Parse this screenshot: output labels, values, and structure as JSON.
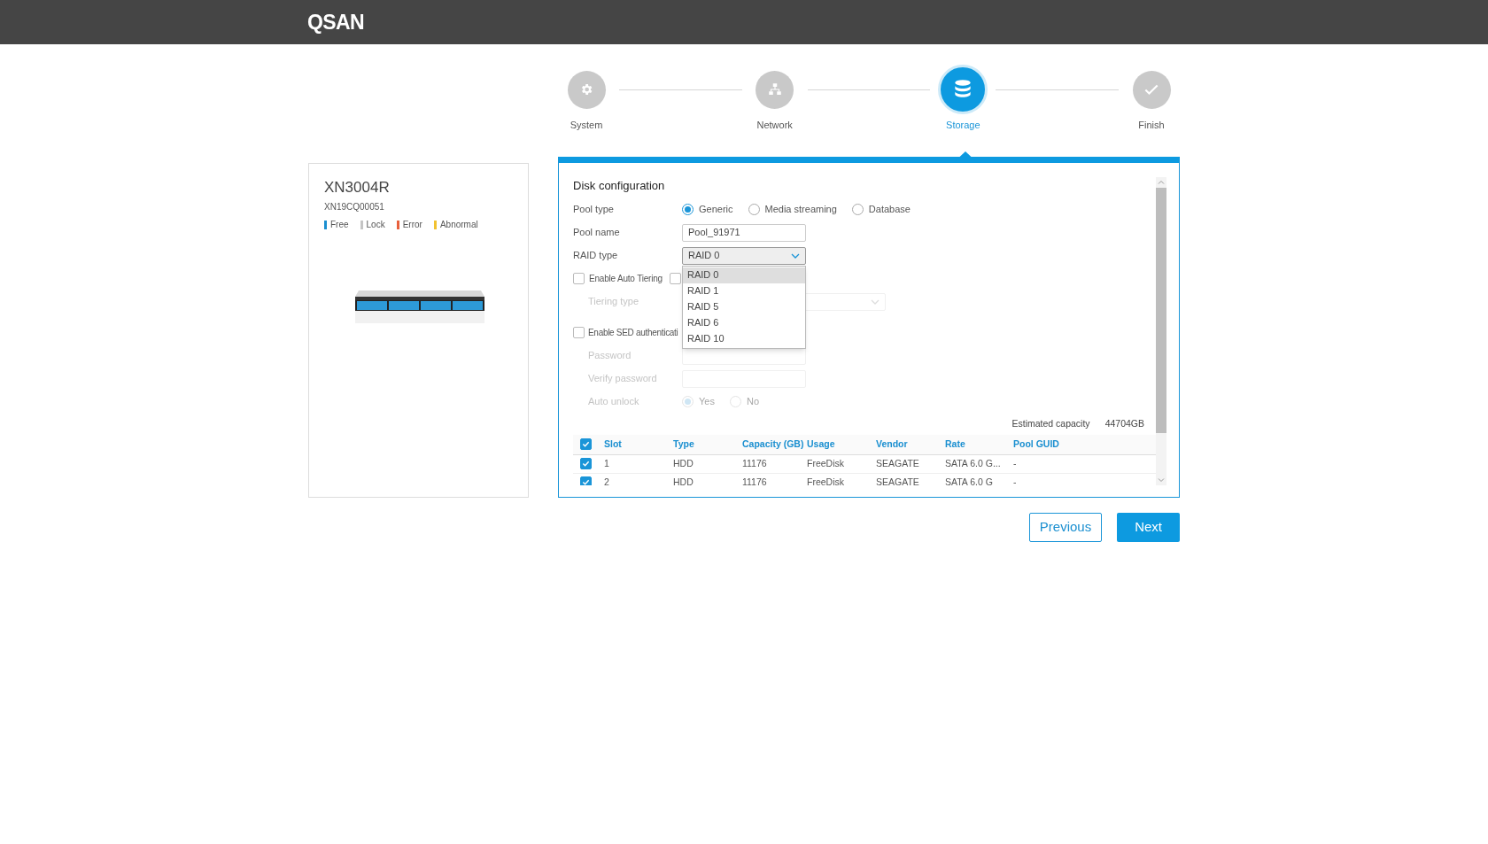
{
  "header": {
    "logo": "QSAN"
  },
  "steps": [
    {
      "label": "System",
      "selected": false
    },
    {
      "label": "Network",
      "selected": false
    },
    {
      "label": "Storage",
      "selected": true
    },
    {
      "label": "Finish",
      "selected": false
    }
  ],
  "device": {
    "model": "XN3004R",
    "serial": "XN19CQ00051",
    "legend": [
      {
        "label": "Free",
        "color": "#1a8fd0"
      },
      {
        "label": "Lock",
        "color": "#c4c4c4"
      },
      {
        "label": "Error",
        "color": "#e8603c"
      },
      {
        "label": "Abnormal",
        "color": "#f2c230"
      }
    ]
  },
  "form": {
    "title": "Disk configuration",
    "pool_type": {
      "label": "Pool type",
      "options": [
        {
          "label": "Generic",
          "selected": true
        },
        {
          "label": "Media streaming",
          "selected": false
        },
        {
          "label": "Database",
          "selected": false
        }
      ]
    },
    "pool_name": {
      "label": "Pool name",
      "value": "Pool_91971"
    },
    "raid_type": {
      "label": "RAID type",
      "value": "RAID 0",
      "expanded": true,
      "options": [
        {
          "label": "RAID 0",
          "selected": true
        },
        {
          "label": "RAID 1",
          "selected": false
        },
        {
          "label": "RAID 5",
          "selected": false
        },
        {
          "label": "RAID 6",
          "selected": false
        },
        {
          "label": "RAID 10",
          "selected": false
        }
      ]
    },
    "auto_tiering": {
      "label": "Enable Auto Tiering",
      "checked": false,
      "second_checkbox": {
        "checked": false
      }
    },
    "tiering_type": {
      "label": "Tiering type",
      "disabled": true
    },
    "sed": {
      "label": "Enable SED authenticati",
      "checked": false
    },
    "password": {
      "label": "Password",
      "disabled": true
    },
    "verify_password": {
      "label": "Verify password",
      "disabled": true
    },
    "auto_unlock": {
      "label": "Auto unlock",
      "disabled": true,
      "options": [
        {
          "label": "Yes",
          "selected": true
        },
        {
          "label": "No",
          "selected": false
        }
      ]
    },
    "estimated_capacity": {
      "label": "Estimated capacity",
      "value": "44704GB"
    }
  },
  "table": {
    "all_checked": true,
    "columns": [
      "Slot",
      "Type",
      "Capacity (GB)",
      "Usage",
      "Vendor",
      "Rate",
      "Pool GUID"
    ],
    "rows": [
      {
        "checked": true,
        "cells": [
          "1",
          "HDD",
          "11176",
          "FreeDisk",
          "SEAGATE",
          "SATA 6.0 G...",
          "-"
        ]
      },
      {
        "checked": true,
        "cells": [
          "2",
          "HDD",
          "11176",
          "FreeDisk",
          "SEAGATE",
          "SATA 6.0 G",
          "-"
        ]
      }
    ]
  },
  "buttons": [
    {
      "label": "Previous",
      "kind": "secondary"
    },
    {
      "label": "Next",
      "kind": "primary"
    }
  ]
}
